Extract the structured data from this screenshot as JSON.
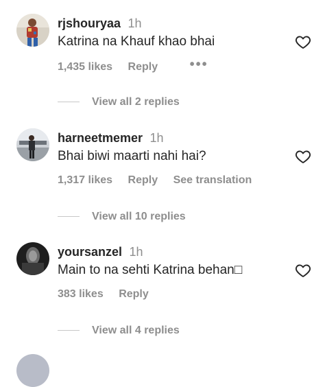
{
  "comments": [
    {
      "username": "rjshouryaa",
      "time": "1h",
      "text": "Katrina na Khauf khao bhai",
      "likes": "1,435 likes",
      "reply": "Reply",
      "more": "•••",
      "view_replies": "View all 2 replies"
    },
    {
      "username": "harneetmemer",
      "time": "1h",
      "text": "Bhai biwi maarti nahi hai?",
      "likes": "1,317 likes",
      "reply": "Reply",
      "translate": "See translation",
      "view_replies": "View all 10 replies"
    },
    {
      "username": "yoursanzel",
      "time": "1h",
      "text": "Main to na sehti Katrina behan□",
      "likes": "383 likes",
      "reply": "Reply",
      "view_replies": "View all 4 replies"
    }
  ]
}
